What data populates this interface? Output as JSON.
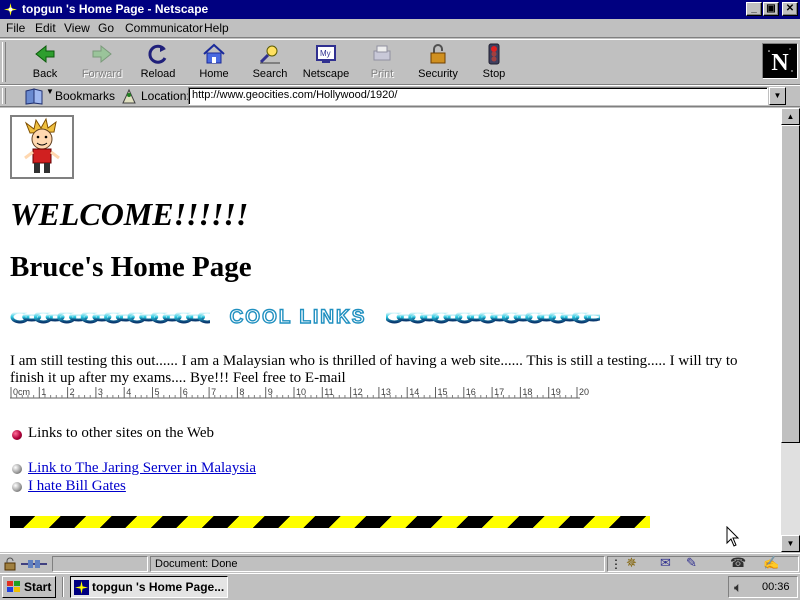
{
  "window": {
    "title": "topgun 's Home Page - Netscape",
    "buttons": {
      "minimize": "_",
      "restore": "▣",
      "close": "✕"
    }
  },
  "menu": [
    "File",
    "Edit",
    "View",
    "Go",
    "Communicator",
    "Help"
  ],
  "toolbar": {
    "back": "Back",
    "forward": "Forward",
    "reload": "Reload",
    "home": "Home",
    "search": "Search",
    "netscape": "Netscape",
    "print": "Print",
    "security": "Security",
    "stop": "Stop"
  },
  "location_bar": {
    "bookmarks_label": "Bookmarks",
    "location_label": "Location:",
    "url": "http://www.geocities.com/Hollywood/1920/"
  },
  "page": {
    "welcome": "WELCOME!!!!!!",
    "heading": "Bruce's Home Page",
    "banner_text": "COOL LINKS",
    "intro": "I am still testing this out...... I am a Malaysian who is thrilled of having a web site...... This is still a testing..... I will try to finish it up after my exams.... Bye!!! Feel free to E-mail",
    "ruler_labels": [
      "0cm",
      "1",
      "2",
      "3",
      "4",
      "5",
      "6",
      "7",
      "8",
      "9",
      "10",
      "11",
      "12",
      "13",
      "14",
      "15",
      "16",
      "17",
      "18",
      "19",
      "20"
    ],
    "links_heading": "Links to other sites on the Web",
    "links": [
      "Link to The Jaring Server in Malaysia",
      "I hate Bill Gates"
    ]
  },
  "status": {
    "text": "Document: Done"
  },
  "taskbar": {
    "start": "Start",
    "task": "topgun 's Home Page...",
    "clock": "00:36"
  },
  "colors": {
    "title_bar": "#000080",
    "link": "#0000cc",
    "chrome": "#c0c0c0"
  }
}
